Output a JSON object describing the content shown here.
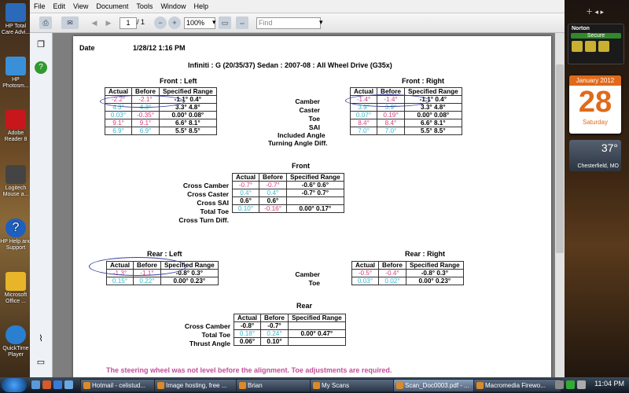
{
  "desktop": {
    "icons": [
      {
        "label": "HP Total Care Advi..."
      },
      {
        "label": "HP Photosm..."
      },
      {
        "label": "Adobe Reader 8"
      },
      {
        "label": "Logitech Mouse a..."
      },
      {
        "label": "HP Help and Support"
      },
      {
        "label": "Microsoft Office ..."
      },
      {
        "label": "QuickTime Player"
      }
    ]
  },
  "gadgets": {
    "norton": {
      "title": "Norton",
      "status": "Secure"
    },
    "calendar": {
      "month": "January 2012",
      "day": "28",
      "weekday": "Saturday"
    },
    "weather": {
      "temp": "37°",
      "location": "Chesterfield, MO"
    }
  },
  "reader": {
    "menu": [
      "File",
      "Edit",
      "View",
      "Document",
      "Tools",
      "Window",
      "Help"
    ],
    "toolbar": {
      "page_current": "1",
      "page_total": "/ 1",
      "zoom": "100%",
      "find_placeholder": "Find"
    }
  },
  "document": {
    "date_label": "Date",
    "date_value": "1/28/12 1:16 PM",
    "vehicle": "Infiniti : G (20/35/37) Sedan : 2007-08 : All Wheel Drive (G35x)",
    "front_left": {
      "title": "Front : Left",
      "headers": [
        "Actual",
        "Before",
        "Specified Range"
      ],
      "rows": [
        [
          "-2.2°",
          "-2.1°",
          "-1.1° 0.4°"
        ],
        [
          "4.3°",
          "4.3°",
          "3.3° 4.8°"
        ],
        [
          "0.03°",
          "-0.35°",
          "0.00° 0.08°"
        ],
        [
          "9.1°",
          "9.1°",
          "6.6° 8.1°"
        ],
        [
          "6.9°",
          "6.9°",
          "5.5° 8.5°"
        ]
      ]
    },
    "front_labels": [
      "Camber",
      "Caster",
      "Toe",
      "SAI",
      "Included Angle",
      "Turning Angle Diff."
    ],
    "front_right": {
      "title": "Front : Right",
      "headers": [
        "Actual",
        "Before",
        "Specified Range"
      ],
      "rows": [
        [
          "-1.4°",
          "-1.4°",
          "-1.1° 0.4°"
        ],
        [
          "3.9°",
          "3.9°",
          "3.3° 4.8°"
        ],
        [
          "0.07°",
          "0.19°",
          "0.00° 0.08°"
        ],
        [
          "8.4°",
          "8.4°",
          "6.6° 8.1°"
        ],
        [
          "7.0°",
          "7.0°",
          "5.5° 8.5°"
        ]
      ]
    },
    "front_cross": {
      "title": "Front",
      "headers": [
        "Actual",
        "Before",
        "Specified Range"
      ],
      "labels": [
        "Cross Camber",
        "Cross Caster",
        "Cross SAI",
        "Total Toe",
        "Cross Turn Diff."
      ],
      "rows": [
        [
          "-0.7°",
          "-0.7°",
          "-0.6° 0.6°"
        ],
        [
          "0.4°",
          "0.4°",
          "-0.7° 0.7°"
        ],
        [
          "0.6°",
          "0.6°",
          ""
        ],
        [
          "0.10°",
          "-0.16°",
          "0.00° 0.17°"
        ]
      ]
    },
    "rear_left": {
      "title": "Rear : Left",
      "headers": [
        "Actual",
        "Before",
        "Specified Range"
      ],
      "rows": [
        [
          "-1.3°",
          "-1.1°",
          "-0.8° 0.3°"
        ],
        [
          "0.15°",
          "0.22°",
          "0.00° 0.23°"
        ]
      ]
    },
    "rear_labels": [
      "Camber",
      "Toe"
    ],
    "rear_right": {
      "title": "Rear : Right",
      "headers": [
        "Actual",
        "Before",
        "Specified Range"
      ],
      "rows": [
        [
          "-0.5°",
          "-0.4°",
          "-0.8° 0.3°"
        ],
        [
          "0.03°",
          "0.02°",
          "0.00° 0.23°"
        ]
      ]
    },
    "rear_cross": {
      "title": "Rear",
      "headers": [
        "Actual",
        "Before",
        "Specified Range"
      ],
      "labels": [
        "Cross Camber",
        "Total Toe",
        "Thrust Angle"
      ],
      "rows": [
        [
          "-0.8°",
          "-0.7°",
          ""
        ],
        [
          "0.18°",
          "0.24°",
          "0.00° 0.47°"
        ],
        [
          "0.06°",
          "0.10°",
          ""
        ]
      ]
    },
    "note": "The steering wheel was not level before the alignment.  Toe adjustments are required."
  },
  "taskbar": {
    "items": [
      "Hotmail - celistud...",
      "Image hosting, free ...",
      "Brian",
      "My Scans",
      "Scan_Doc0003.pdf - ...",
      "Macromedia Firewo..."
    ],
    "clock": "11:04 PM"
  }
}
